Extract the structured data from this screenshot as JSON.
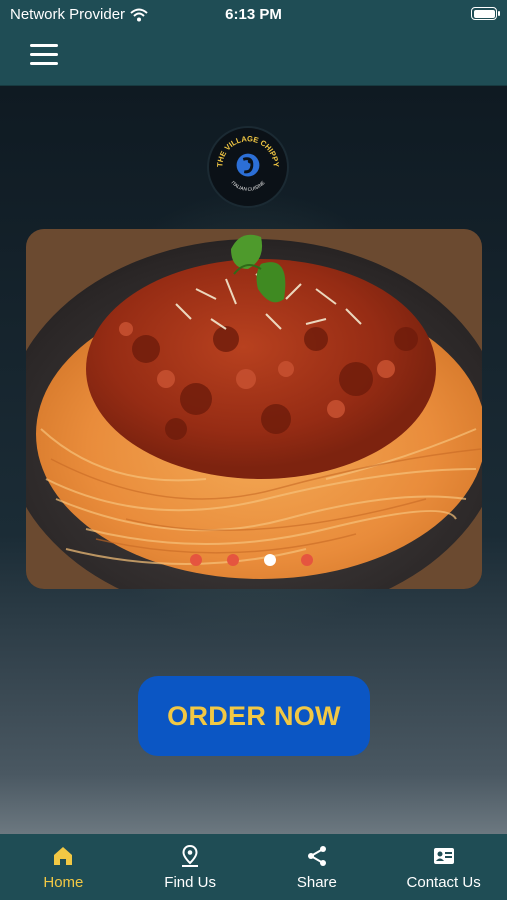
{
  "status_bar": {
    "provider": "Network Provider",
    "time": "6:13 PM"
  },
  "logo": {
    "line1": "THE VILLAGE CHIPPY",
    "line2": "ITALIAN CUISINE"
  },
  "carousel": {
    "image": "spaghetti-bolognese",
    "slide_count": 4,
    "active_index": 2
  },
  "order_button": {
    "label": "ORDER NOW"
  },
  "tabs": [
    {
      "label": "Home",
      "icon": "home-icon",
      "active": true
    },
    {
      "label": "Find Us",
      "icon": "location-pin-icon",
      "active": false
    },
    {
      "label": "Share",
      "icon": "share-icon",
      "active": false
    },
    {
      "label": "Contact Us",
      "icon": "contact-card-icon",
      "active": false
    }
  ],
  "colors": {
    "bar": "#1f4d55",
    "accent": "#f2c844",
    "button": "#0b56c4",
    "dot": "#e5553f"
  }
}
